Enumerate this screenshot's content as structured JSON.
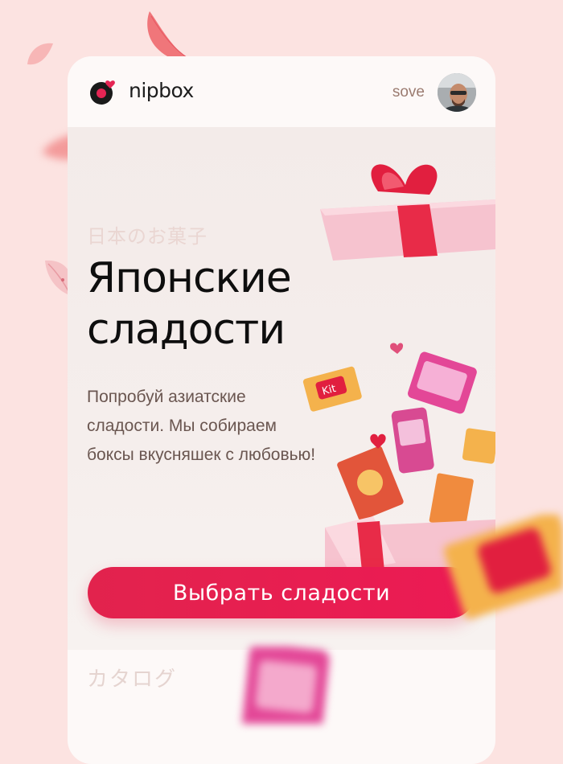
{
  "header": {
    "brand": "nipbox",
    "username": "sove"
  },
  "hero": {
    "jp_title": "日本のお菓子",
    "title_line1": "Японские",
    "title_line2": "сладости",
    "description": "Попробуй азиатские сладости. Мы собираем боксы вкусняшек с любовью!",
    "cta_label": "Выбрать сладости"
  },
  "catalog": {
    "jp_title": "カタログ"
  },
  "colors": {
    "background": "#fce3e1",
    "accent": "#e2234d",
    "title": "#0e0e0e",
    "text": "#6a5650"
  },
  "icons": [
    "nipbox-logo-icon",
    "avatar",
    "gift-box-illustration",
    "petal-decoration"
  ]
}
